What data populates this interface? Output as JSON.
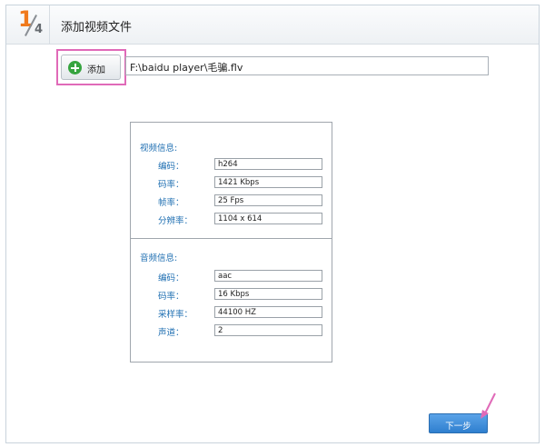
{
  "header": {
    "step_current": "1",
    "step_total": "4",
    "title": "添加视频文件"
  },
  "add_button": {
    "label": "添加"
  },
  "file_path": {
    "value": "F:\\baidu player\\毛骗.flv"
  },
  "video_info": {
    "title": "视频信息:",
    "fields": [
      {
        "label": "编码：",
        "value": "h264"
      },
      {
        "label": "码率：",
        "value": "1421 Kbps"
      },
      {
        "label": "帧率：",
        "value": "25 Fps"
      },
      {
        "label": "分辨率：",
        "value": "1104 x 614"
      }
    ]
  },
  "audio_info": {
    "title": "音频信息:",
    "fields": [
      {
        "label": "编码：",
        "value": "aac"
      },
      {
        "label": "码率：",
        "value": "16 Kbps"
      },
      {
        "label": "采样率：",
        "value": "44100 HZ"
      },
      {
        "label": "声道：",
        "value": "2"
      }
    ]
  },
  "next_button": {
    "label": "下一步"
  },
  "colors": {
    "step_accent": "#f07a1d",
    "highlight": "#e06ab8",
    "info_text": "#1f6fb2",
    "primary_button": "#3a8ad8"
  },
  "icons": {
    "add": "plus-circle-icon",
    "annotation": "arrow-annotation-icon"
  }
}
